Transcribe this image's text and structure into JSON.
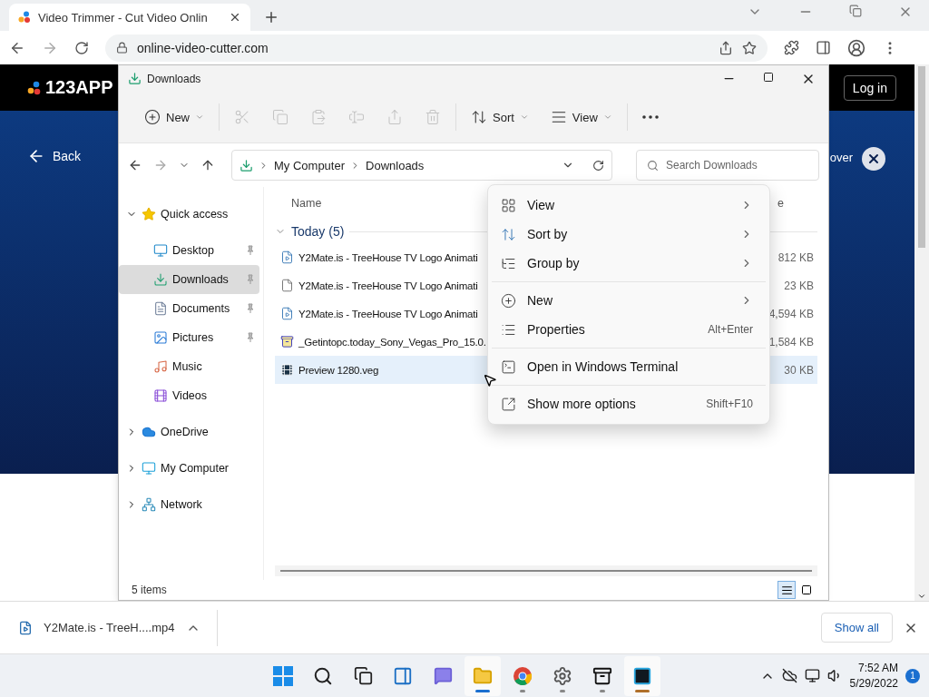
{
  "browser": {
    "tab": {
      "title": "Video Trimmer - Cut Video Onlin"
    },
    "url": "online-video-cutter.com"
  },
  "page": {
    "logo": "123APP",
    "login": "Log in",
    "back": "Back",
    "heading_fragment": "over"
  },
  "explorer": {
    "title": "Downloads",
    "command_groups": [
      {
        "commands": [
          {
            "kind": "new",
            "label": "New",
            "disabled": false
          }
        ]
      },
      {
        "commands": [
          {
            "kind": "cut",
            "disabled": true
          },
          {
            "kind": "copy",
            "disabled": true
          },
          {
            "kind": "paste",
            "disabled": true
          },
          {
            "kind": "rename",
            "disabled": true
          },
          {
            "kind": "share",
            "disabled": true
          },
          {
            "kind": "delete",
            "disabled": true
          }
        ]
      },
      {
        "commands": [
          {
            "kind": "sort",
            "label": "Sort",
            "disabled": false
          },
          {
            "kind": "view",
            "label": "View",
            "disabled": false
          }
        ]
      },
      {
        "commands": [
          {
            "kind": "more",
            "disabled": false
          }
        ]
      }
    ],
    "breadcrumbs": [
      "My Computer",
      "Downloads"
    ],
    "search": {
      "placeholder": "Search Downloads"
    },
    "nav": [
      {
        "label": "Quick access",
        "kind": "star",
        "expanded": true,
        "selected": false,
        "children": [
          {
            "label": "Desktop",
            "kind": "desktop",
            "pinned": true,
            "selected": false
          },
          {
            "label": "Downloads",
            "kind": "downloads",
            "pinned": true,
            "selected": true
          },
          {
            "label": "Documents",
            "kind": "documents",
            "pinned": true,
            "selected": false
          },
          {
            "label": "Pictures",
            "kind": "pictures",
            "pinned": true,
            "selected": false
          },
          {
            "label": "Music",
            "kind": "music",
            "pinned": false,
            "selected": false
          },
          {
            "label": "Videos",
            "kind": "videos",
            "pinned": false,
            "selected": false
          }
        ]
      },
      {
        "label": "OneDrive",
        "kind": "cloud",
        "expanded": false,
        "selected": false
      },
      {
        "label": "My Computer",
        "kind": "computer",
        "expanded": false,
        "selected": false
      },
      {
        "label": "Network",
        "kind": "network",
        "expanded": false,
        "selected": false
      }
    ],
    "columns": [
      {
        "label": "Name"
      },
      {
        "label": "e"
      }
    ],
    "group": {
      "label": "Today (5)",
      "expanded": true
    },
    "files": [
      {
        "name": "Y2Mate.is - TreeHouse TV Logo Animati",
        "size": "812 KB",
        "kind": "video",
        "selected": false
      },
      {
        "name": "Y2Mate.is - TreeHouse TV Logo Animati",
        "size": "23 KB",
        "kind": "file",
        "selected": false
      },
      {
        "name": "Y2Mate.is - TreeHouse TV Logo Animati",
        "size": "4,594 KB",
        "kind": "video",
        "selected": false
      },
      {
        "name": "_Getintopc.today_Sony_Vegas_Pro_15.0.",
        "size": "1,584 KB",
        "kind": "archive",
        "selected": false
      },
      {
        "name": "Preview 1280.veg",
        "size": "30 KB",
        "kind": "veg",
        "selected": true
      }
    ],
    "status": "5 items",
    "view_modes": [
      {
        "kind": "details",
        "selected": true
      },
      {
        "kind": "tiles",
        "selected": false
      }
    ]
  },
  "context_menu": {
    "sections": [
      {
        "items": [
          {
            "kind": "view",
            "label": "View",
            "submenu": true
          },
          {
            "kind": "sort",
            "label": "Sort by",
            "submenu": true
          },
          {
            "kind": "group",
            "label": "Group by",
            "submenu": true
          }
        ]
      },
      {
        "items": [
          {
            "kind": "new",
            "label": "New",
            "submenu": true
          },
          {
            "kind": "properties",
            "label": "Properties",
            "shortcut": "Alt+Enter",
            "submenu": false
          }
        ]
      },
      {
        "items": [
          {
            "kind": "terminal",
            "label": "Open in Windows Terminal",
            "submenu": false
          }
        ]
      },
      {
        "items": [
          {
            "kind": "more",
            "label": "Show more options",
            "shortcut": "Shift+F10",
            "submenu": false
          }
        ]
      }
    ]
  },
  "download_bar": {
    "file": "Y2Mate.is - TreeH....mp4",
    "show_all": "Show all"
  },
  "taskbar": {
    "apps": [
      {
        "kind": "start",
        "running": false,
        "active": false
      },
      {
        "kind": "search",
        "running": false,
        "active": false
      },
      {
        "kind": "taskview",
        "running": false,
        "active": false
      },
      {
        "kind": "widgets",
        "running": false,
        "active": false
      },
      {
        "kind": "chat",
        "running": false,
        "active": false
      },
      {
        "kind": "explorer",
        "running": true,
        "active": true
      },
      {
        "kind": "chrome",
        "running": true,
        "active": false
      },
      {
        "kind": "settings",
        "running": true,
        "active": false
      },
      {
        "kind": "archiver",
        "running": true,
        "active": false
      },
      {
        "kind": "vegas",
        "running": true,
        "active": true
      }
    ],
    "time": "7:52 AM",
    "date": "5/29/2022",
    "notifications": "1"
  }
}
